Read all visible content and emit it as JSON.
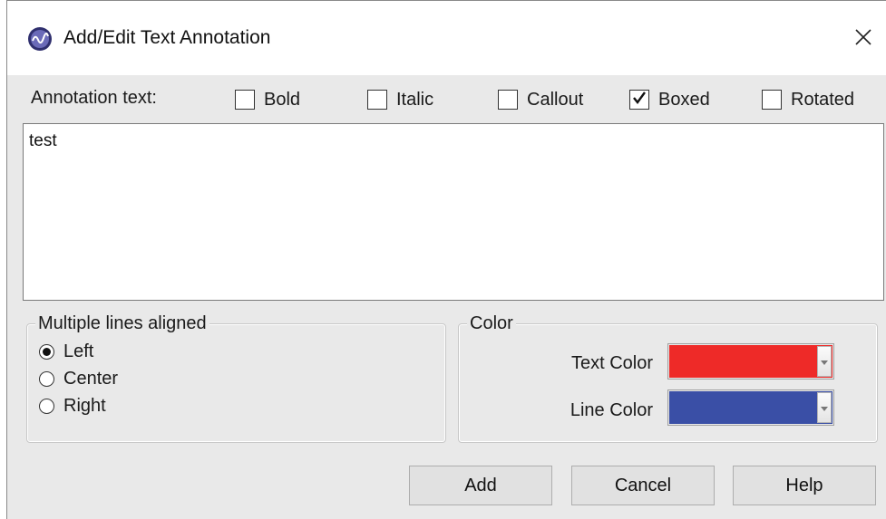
{
  "window": {
    "title": "Add/Edit Text Annotation",
    "icon": "app-logo-icon",
    "close_icon": "close-icon"
  },
  "annotation": {
    "label": "Annotation text:",
    "options": [
      {
        "label": "Bold",
        "checked": false
      },
      {
        "label": "Italic",
        "checked": false
      },
      {
        "label": "Callout",
        "checked": false
      },
      {
        "label": "Boxed",
        "checked": true
      },
      {
        "label": "Rotated",
        "checked": false
      }
    ],
    "text": "test"
  },
  "alignment": {
    "legend": "Multiple lines aligned",
    "options": [
      {
        "label": "Left",
        "selected": true
      },
      {
        "label": "Center",
        "selected": false
      },
      {
        "label": "Right",
        "selected": false
      }
    ]
  },
  "color": {
    "legend": "Color",
    "text_color_label": "Text Color",
    "text_color_value": "#ee2a28",
    "line_color_label": "Line Color",
    "line_color_value": "#3a4fa6"
  },
  "buttons": {
    "add": "Add",
    "cancel": "Cancel",
    "help": "Help"
  }
}
